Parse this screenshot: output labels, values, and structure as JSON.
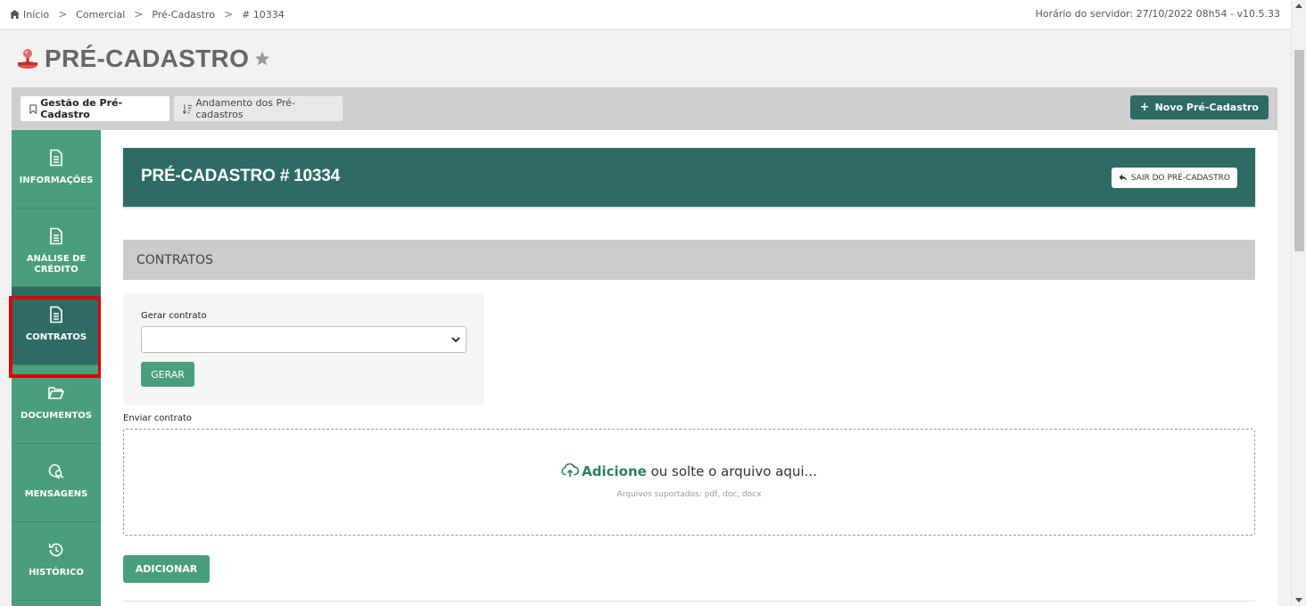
{
  "breadcrumb": {
    "items": [
      {
        "label": "Início"
      },
      {
        "label": "Comercial"
      },
      {
        "label": "Pré-Cadastro"
      },
      {
        "label": "# 10334"
      }
    ],
    "separator": ">"
  },
  "server_time": "Horário do servidor: 27/10/2022 08h54 - v10.5.33",
  "page": {
    "title": "PRÉ-CADASTRO",
    "icon": "joystick-icon",
    "favorite_icon": "star-icon"
  },
  "tabs": [
    {
      "label": "Gestão de Pré-Cadastro",
      "icon": "bookmark-icon",
      "active": true
    },
    {
      "label": "Andamento dos Pré-cadastros",
      "icon": "sort-icon",
      "active": false
    }
  ],
  "new_button": {
    "label": "Novo Pré-Cadastro",
    "icon": "plus-icon"
  },
  "sidebar": {
    "items": [
      {
        "label": "INFORMAÇÕES",
        "icon": "document-icon"
      },
      {
        "label": "ANÁLISE DE CRÉDITO",
        "icon": "document-icon"
      },
      {
        "label": "CONTRATOS",
        "icon": "document-icon",
        "active": true
      },
      {
        "label": "DOCUMENTOS",
        "icon": "folder-open-icon"
      },
      {
        "label": "MENSAGENS",
        "icon": "chat-search-icon"
      },
      {
        "label": "HISTÓRICO",
        "icon": "history-icon"
      }
    ]
  },
  "header": {
    "title": "PRÉ-CADASTRO # 10334",
    "exit_button": "SAIR DO PRÉ-CADASTRO"
  },
  "section": {
    "title": "CONTRATOS"
  },
  "generate": {
    "label": "Gerar contrato",
    "selected": "",
    "button": "GERAR"
  },
  "upload": {
    "label": "Enviar contrato",
    "add_word": "Adicione",
    "rest": " ou solte o arquivo aqui...",
    "supported": "Arquivos suportados: pdf, doc, docx",
    "button": "ADICIONAR"
  },
  "colors": {
    "primary_dark": "#2e6b65",
    "primary": "#4b9e7b",
    "highlight": "#e00000"
  }
}
